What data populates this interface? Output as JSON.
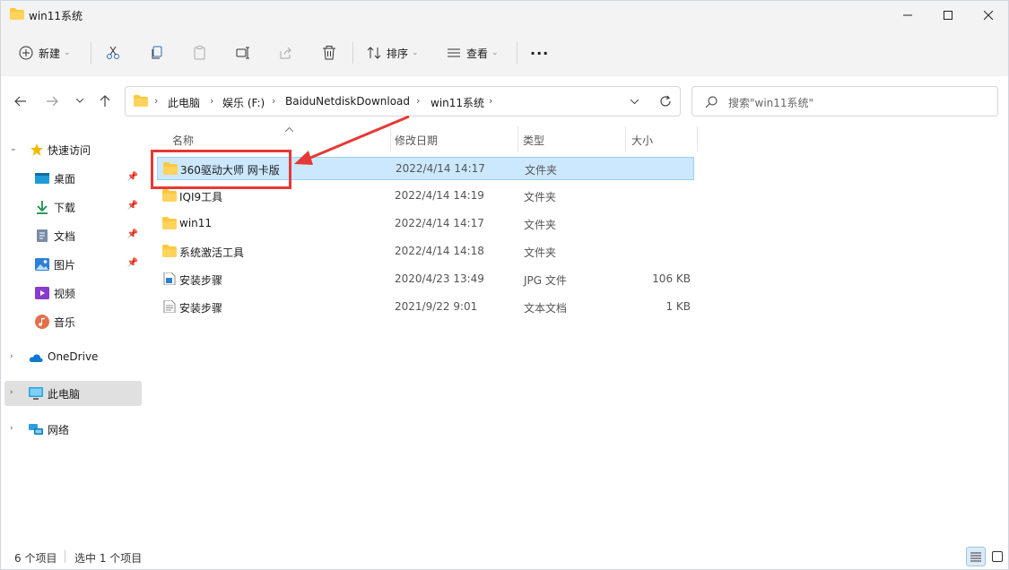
{
  "window": {
    "title": "win11系统",
    "controls": [
      "minimize-icon",
      "maximize-icon",
      "close-icon"
    ]
  },
  "toolbar": {
    "new_label": "新建",
    "sort_label": "排序",
    "view_label": "查看",
    "more_label": "···",
    "icons": [
      "cut-icon",
      "copy-icon",
      "paste-icon",
      "rename-icon",
      "share-icon",
      "delete-icon"
    ]
  },
  "address": {
    "crumbs": [
      "此电脑",
      "娱乐 (F:)",
      "BaiduNetdiskDownload",
      "win11系统"
    ]
  },
  "search": {
    "placeholder": "搜索\"win11系统\""
  },
  "sidebar": {
    "quick_access": "快速访问",
    "items": [
      {
        "label": "桌面",
        "icon": "desktop-icon"
      },
      {
        "label": "下载",
        "icon": "download-icon"
      },
      {
        "label": "文档",
        "icon": "document-icon"
      },
      {
        "label": "图片",
        "icon": "pictures-icon"
      },
      {
        "label": "视频",
        "icon": "videos-icon"
      },
      {
        "label": "音乐",
        "icon": "music-icon"
      }
    ],
    "onedrive": "OneDrive",
    "this_pc": "此电脑",
    "network": "网络"
  },
  "columns": {
    "name": "名称",
    "date": "修改日期",
    "type": "类型",
    "size": "大小"
  },
  "files": [
    {
      "name": "360驱动大师 网卡版",
      "date": "2022/4/14 14:17",
      "type": "文件夹",
      "size": "",
      "icon": "folder-icon"
    },
    {
      "name": "IQI9工具",
      "date": "2022/4/14 14:19",
      "type": "文件夹",
      "size": "",
      "icon": "folder-icon"
    },
    {
      "name": "win11",
      "date": "2022/4/14 14:17",
      "type": "文件夹",
      "size": "",
      "icon": "folder-icon"
    },
    {
      "name": "系统激活工具",
      "date": "2022/4/14 14:18",
      "type": "文件夹",
      "size": "",
      "icon": "folder-icon"
    },
    {
      "name": "安装步骤",
      "date": "2020/4/23 13:49",
      "type": "JPG 文件",
      "size": "106 KB",
      "icon": "image-file-icon"
    },
    {
      "name": "安装步骤",
      "date": "2021/9/22 9:01",
      "type": "文本文档",
      "size": "1 KB",
      "icon": "text-file-icon"
    }
  ],
  "status": {
    "count": "6 个项目",
    "selected": "选中 1 个项目"
  },
  "colors": {
    "selection": "#cce8ff",
    "selection_border": "#99d1ff",
    "highlight": "#e53935",
    "folder": "#ffc83d"
  }
}
